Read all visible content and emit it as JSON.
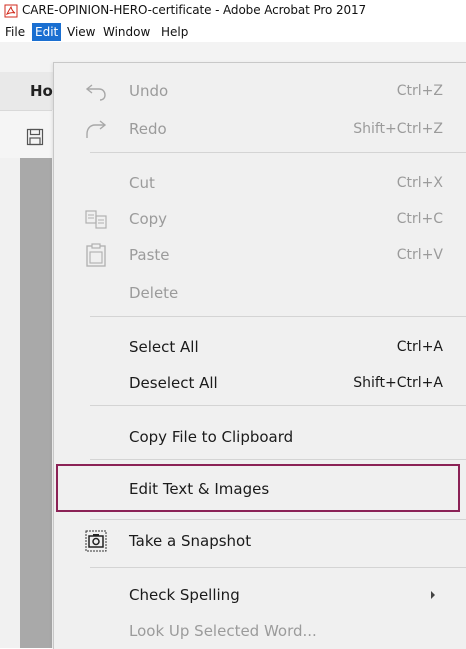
{
  "window": {
    "title": "CARE-OPINION-HERO-certificate - Adobe Acrobat Pro 2017"
  },
  "menubar": {
    "items": [
      "File",
      "Edit",
      "View",
      "Window",
      "Help"
    ],
    "active": "Edit"
  },
  "background": {
    "home_tab": "Ho"
  },
  "edit_menu": {
    "undo": {
      "label": "Undo",
      "shortcut": "Ctrl+Z",
      "icon": "undo-icon"
    },
    "redo": {
      "label": "Redo",
      "shortcut": "Shift+Ctrl+Z",
      "icon": "redo-icon"
    },
    "cut": {
      "label": "Cut",
      "shortcut": "Ctrl+X"
    },
    "copy": {
      "label": "Copy",
      "shortcut": "Ctrl+C",
      "icon": "copy-icon"
    },
    "paste": {
      "label": "Paste",
      "shortcut": "Ctrl+V",
      "icon": "paste-icon"
    },
    "delete": {
      "label": "Delete"
    },
    "select_all": {
      "label": "Select All",
      "shortcut": "Ctrl+A"
    },
    "deselect_all": {
      "label": "Deselect All",
      "shortcut": "Shift+Ctrl+A"
    },
    "copy_file": {
      "label": "Copy File to Clipboard"
    },
    "edit_text": {
      "label": "Edit Text & Images"
    },
    "snapshot": {
      "label": "Take a Snapshot",
      "icon": "camera-icon"
    },
    "check_spelling": {
      "label": "Check Spelling"
    },
    "look_up": {
      "label": "Look Up Selected Word..."
    }
  },
  "colors": {
    "menu_bg": "#f0f0f0",
    "active_menu": "#1a6fd1",
    "highlight_border": "#8b2256",
    "disabled_text": "#9b9b9b"
  }
}
